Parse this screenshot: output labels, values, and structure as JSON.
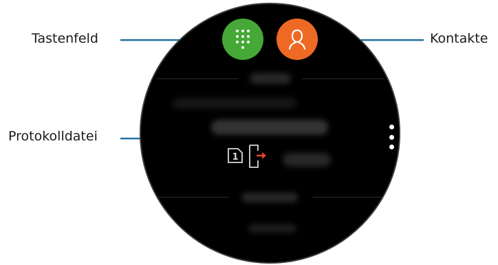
{
  "labels": {
    "keypad": "Tastenfeld",
    "contacts": "Kontakte",
    "log": "Protokolldatei"
  },
  "icons": {
    "keypad": "dialpad-icon",
    "contacts": "contact-person-icon",
    "more": "more-options-icon",
    "log_sim": "sim-1-icon",
    "log_call": "outgoing-call-icon"
  },
  "colors": {
    "keypad_button": "#46a836",
    "contacts_button": "#ee6a24",
    "leader_line": "#1d6fa3",
    "watch_face": "#000000",
    "outgoing_arrow": "#e0432a"
  },
  "log": {
    "sim_number": "1"
  }
}
